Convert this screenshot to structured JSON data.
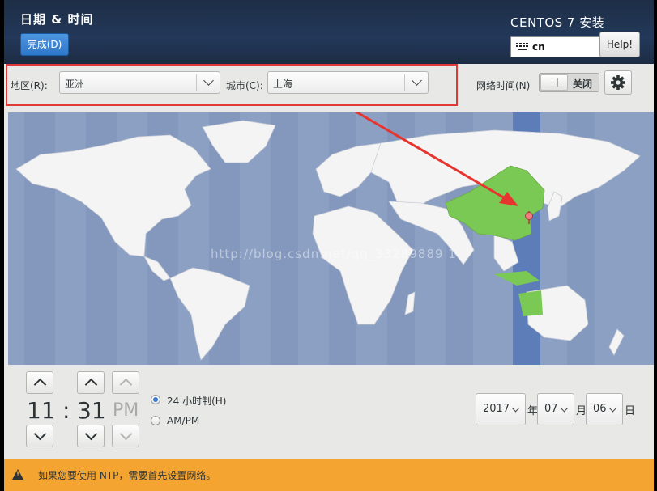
{
  "header": {
    "title": "日期 & 时间",
    "done_button": "完成(D)",
    "product": "CENTOS 7 安装",
    "keyboard_layout": "cn",
    "help_button": "Help!"
  },
  "toolbar": {
    "region_label": "地区(R):",
    "region_value": "亚洲",
    "city_label": "城市(C):",
    "city_value": "上海",
    "network_time_label": "网络时间(N)",
    "network_time_state": "关闭"
  },
  "map": {
    "watermark": "http://blog.csdn.net/qq_33289889 1",
    "highlight_color": "#7bc955",
    "land_color": "#f4f4f4",
    "ocean_color": "#8ca0c4",
    "selected_zone_color": "#5d7db8",
    "arrow_color": "#e8342e"
  },
  "time": {
    "hours": "11",
    "separator": ":",
    "minutes": "31",
    "ampm": "PM",
    "format_24h_label": "24 小时制(H)",
    "format_ampm_label": "AM/PM",
    "selected_format": "24h"
  },
  "date": {
    "year": "2017",
    "year_unit": "年",
    "month": "07",
    "month_unit": "月",
    "day": "06",
    "day_unit": "日"
  },
  "warning": {
    "text": "如果您要使用 NTP，需要首先设置网络。",
    "color": "#f4a531"
  }
}
